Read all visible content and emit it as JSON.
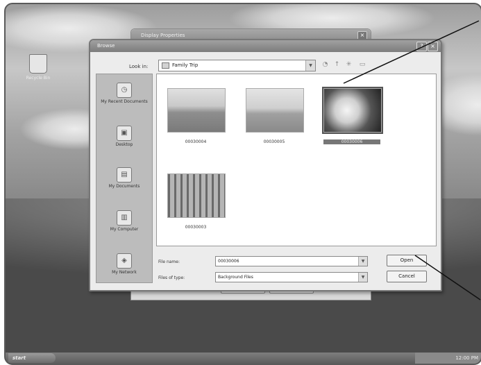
{
  "desktop": {
    "icon_label": "Recycle Bin"
  },
  "background_window": {
    "title": "Display Properties"
  },
  "dialog": {
    "title": "Browse",
    "look_in_label": "Look in:",
    "look_in_value": "Family Trip",
    "places": [
      "My Recent Documents",
      "Desktop",
      "My Documents",
      "My Computer",
      "My Network"
    ],
    "files": [
      {
        "name": "00030004",
        "selected": false
      },
      {
        "name": "00030005",
        "selected": false
      },
      {
        "name": "00030006",
        "selected": true
      },
      {
        "name": "00030003",
        "selected": false
      }
    ],
    "file_name_label": "File name:",
    "file_name_value": "00030006",
    "files_of_type_label": "Files of type:",
    "files_of_type_value": "Background Files",
    "open_button": "Open",
    "cancel_button": "Cancel"
  },
  "taskbar": {
    "start_label": "start",
    "clock": "12:00 PM"
  }
}
